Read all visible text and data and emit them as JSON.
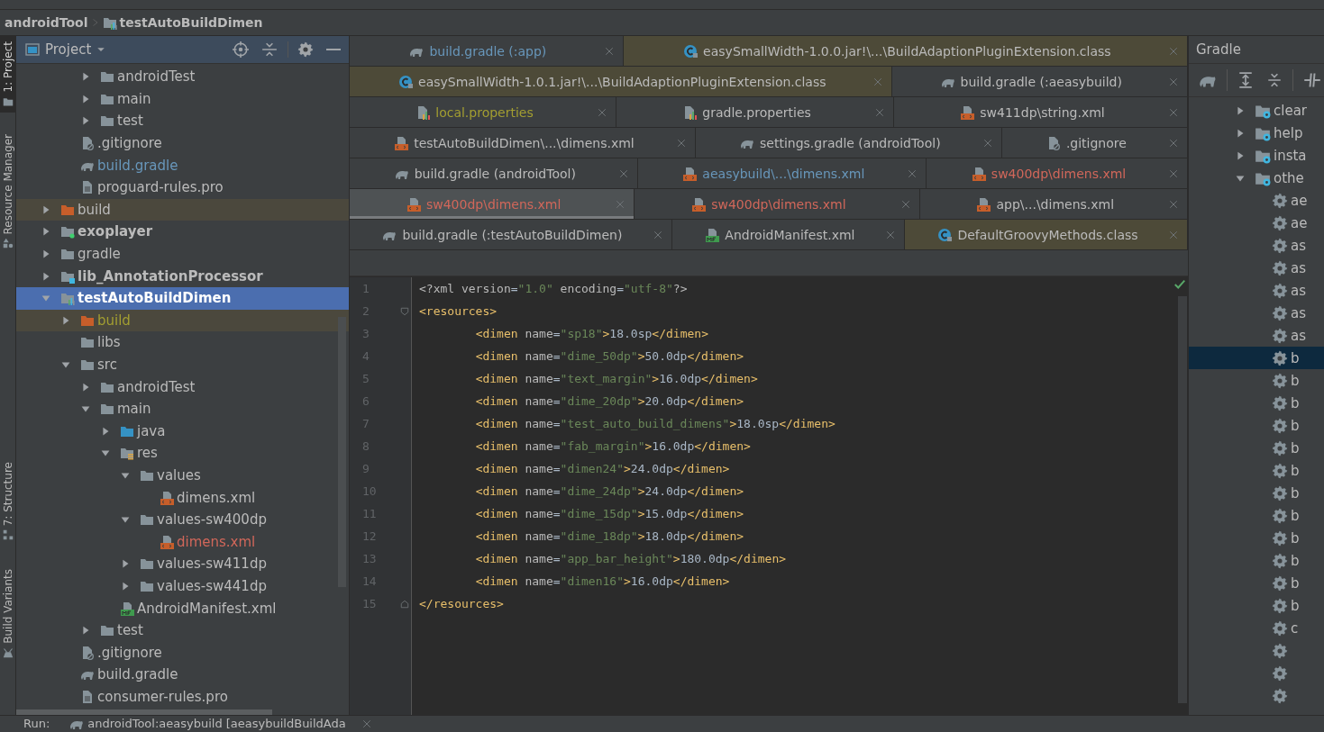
{
  "breadcrumb": [
    {
      "label": "androidTool",
      "kind": "plain"
    },
    {
      "label": "testAutoBuildDimen",
      "kind": "module"
    }
  ],
  "side_tools": [
    {
      "label": "1: Project",
      "selected": true,
      "kind": "folder"
    },
    {
      "label": "Resource Manager",
      "selected": false,
      "kind": "shapes"
    },
    {
      "label": "7: Structure",
      "selected": false,
      "kind": "structure"
    },
    {
      "label": "Build Variants",
      "selected": false,
      "kind": "variants"
    }
  ],
  "project_panel": {
    "title": "Project",
    "tree": [
      {
        "children": [
          {
            "children": [
              {
                "label": "androidTest",
                "kind": "folder",
                "expanded": false
              },
              {
                "label": "main",
                "kind": "folder",
                "expanded": false
              },
              {
                "label": "test",
                "kind": "folder",
                "expanded": false
              }
            ]
          },
          {
            "label": ".gitignore",
            "kind": "ignore"
          },
          {
            "label": "build.gradle",
            "kind": "gradle",
            "color": "#6897bb"
          },
          {
            "label": "proguard-rules.pro",
            "kind": "text"
          }
        ]
      },
      {
        "label": "build",
        "kind": "excluded",
        "expanded": false
      },
      {
        "label": "exoplayer",
        "kind": "module-green",
        "expanded": false
      },
      {
        "label": "gradle",
        "kind": "folder",
        "expanded": false
      },
      {
        "label": "lib_AnnotationProcessor",
        "kind": "module-blue",
        "expanded": false
      },
      {
        "label": "testAutoBuildDimen",
        "kind": "module",
        "expanded": true,
        "selected": true,
        "children": [
          {
            "label": "build",
            "kind": "excluded",
            "expanded": false,
            "color": "#a39e31"
          },
          {
            "label": "libs",
            "kind": "folder"
          },
          {
            "label": "src",
            "kind": "folder",
            "expanded": true,
            "children": [
              {
                "label": "androidTest",
                "kind": "folder",
                "expanded": false
              },
              {
                "label": "main",
                "kind": "folder",
                "expanded": true,
                "children": [
                  {
                    "label": "java",
                    "kind": "source",
                    "expanded": false
                  },
                  {
                    "label": "res",
                    "kind": "resources",
                    "expanded": true,
                    "children": [
                      {
                        "label": "values",
                        "kind": "folder",
                        "expanded": true,
                        "children": [
                          {
                            "label": "dimens.xml",
                            "kind": "xml"
                          }
                        ]
                      },
                      {
                        "label": "values-sw400dp",
                        "kind": "folder",
                        "expanded": true,
                        "children": [
                          {
                            "label": "dimens.xml",
                            "kind": "xml",
                            "color": "#d1675a"
                          }
                        ]
                      },
                      {
                        "label": "values-sw411dp",
                        "kind": "folder",
                        "expanded": false
                      },
                      {
                        "label": "values-sw441dp",
                        "kind": "folder",
                        "expanded": false
                      }
                    ]
                  },
                  {
                    "label": "AndroidManifest.xml",
                    "kind": "manifest"
                  }
                ]
              },
              {
                "label": "test",
                "kind": "folder",
                "expanded": false
              }
            ]
          },
          {
            "label": ".gitignore",
            "kind": "ignore"
          },
          {
            "label": "build.gradle",
            "kind": "gradle"
          },
          {
            "label": "consumer-rules.pro",
            "kind": "text"
          }
        ]
      }
    ]
  },
  "editor_tabs": [
    [
      {
        "label": "build.gradle (:app)",
        "kind": "gradle",
        "color": "#6897bb",
        "selected": false,
        "external": false
      },
      {
        "label": "easySmallWidth-1.0.0.jar!\\...\\BuildAdaptionPluginExtension.class",
        "kind": "class",
        "selected": false,
        "external": true
      }
    ],
    [
      {
        "label": "easySmallWidth-1.0.1.jar!\\...\\BuildAdaptionPluginExtension.class",
        "kind": "class",
        "selected": false,
        "external": true
      },
      {
        "label": "build.gradle (:aeasybuild)",
        "kind": "gradle",
        "selected": false,
        "external": false
      }
    ],
    [
      {
        "label": "local.properties",
        "kind": "properties",
        "color": "#a39e31",
        "selected": false,
        "external": false
      },
      {
        "label": "gradle.properties",
        "kind": "properties",
        "selected": false,
        "external": false
      },
      {
        "label": "sw411dp\\string.xml",
        "kind": "xml",
        "selected": false,
        "external": false
      }
    ],
    [
      {
        "label": "testAutoBuildDimen\\...\\dimens.xml",
        "kind": "xml",
        "selected": false,
        "external": false
      },
      {
        "label": "settings.gradle (androidTool)",
        "kind": "gradle",
        "selected": false,
        "external": false
      },
      {
        "label": ".gitignore",
        "kind": "ignore",
        "selected": false,
        "external": false
      }
    ],
    [
      {
        "label": "build.gradle (androidTool)",
        "kind": "gradle",
        "selected": false,
        "external": false
      },
      {
        "label": "aeasybuild\\...\\dimens.xml",
        "kind": "xml",
        "color": "#6897bb",
        "selected": false,
        "external": false
      },
      {
        "label": "sw400dp\\dimens.xml",
        "kind": "xml",
        "color": "#d1675a",
        "selected": false,
        "external": false
      }
    ],
    [
      {
        "label": "sw400dp\\dimens.xml",
        "kind": "xml",
        "color": "#d1675a",
        "selected": true,
        "external": false
      },
      {
        "label": "sw400dp\\dimens.xml",
        "kind": "xml",
        "color": "#d1675a",
        "selected": false,
        "external": false
      },
      {
        "label": "app\\...\\dimens.xml",
        "kind": "xml",
        "selected": false,
        "external": false
      }
    ],
    [
      {
        "label": "build.gradle (:testAutoBuildDimen)",
        "kind": "gradle",
        "selected": false,
        "external": false
      },
      {
        "label": "AndroidManifest.xml",
        "kind": "manifest",
        "selected": false,
        "external": false
      },
      {
        "label": "DefaultGroovyMethods.class",
        "kind": "class",
        "selected": false,
        "external": true
      }
    ]
  ],
  "code": [
    {
      "number": "1",
      "text": "<?xml version=\"1.0\" encoding=\"utf-8\"?>",
      "kind": "plain"
    },
    {
      "number": "2",
      "text": "<resources>",
      "kind": "fold-start"
    },
    {
      "number": "3",
      "text": "        <dimen name=\"sp18\">18.0sp</dimen>",
      "kind": "plain"
    },
    {
      "number": "4",
      "text": "        <dimen name=\"dime_50dp\">50.0dp</dimen>",
      "kind": "plain"
    },
    {
      "number": "5",
      "text": "        <dimen name=\"text_margin\">16.0dp</dimen>",
      "kind": "plain"
    },
    {
      "number": "6",
      "text": "        <dimen name=\"dime_20dp\">20.0dp</dimen>",
      "kind": "plain"
    },
    {
      "number": "7",
      "text": "        <dimen name=\"test_auto_build_dimens\">18.0sp</dimen>",
      "kind": "plain"
    },
    {
      "number": "8",
      "text": "        <dimen name=\"fab_margin\">16.0dp</dimen>",
      "kind": "plain"
    },
    {
      "number": "9",
      "text": "        <dimen name=\"dimen24\">24.0dp</dimen>",
      "kind": "plain"
    },
    {
      "number": "10",
      "text": "        <dimen name=\"dime_24dp\">24.0dp</dimen>",
      "kind": "plain"
    },
    {
      "number": "11",
      "text": "        <dimen name=\"dime_15dp\">15.0dp</dimen>",
      "kind": "plain"
    },
    {
      "number": "12",
      "text": "        <dimen name=\"dime_18dp\">18.0dp</dimen>",
      "kind": "plain"
    },
    {
      "number": "13",
      "text": "        <dimen name=\"app_bar_height\">180.0dp</dimen>",
      "kind": "plain"
    },
    {
      "number": "14",
      "text": "        <dimen name=\"dimen16\">16.0dp</dimen>",
      "kind": "plain"
    },
    {
      "number": "15",
      "text": "</resources>",
      "kind": "fold-end"
    }
  ],
  "gradle_panel": {
    "title": "Gradle",
    "tasks": [
      {
        "label": "clear",
        "kind": "group",
        "expanded": false
      },
      {
        "label": "help",
        "kind": "group",
        "expanded": false
      },
      {
        "label": "insta",
        "kind": "group",
        "expanded": false
      },
      {
        "label": "othe",
        "kind": "group",
        "expanded": true,
        "children": [
          {
            "label": "ae",
            "kind": "task",
            "selected": false
          },
          {
            "label": "ae",
            "kind": "task",
            "selected": false
          },
          {
            "label": "as",
            "kind": "task",
            "selected": false
          },
          {
            "label": "as",
            "kind": "task",
            "selected": false
          },
          {
            "label": "as",
            "kind": "task",
            "selected": false
          },
          {
            "label": "as",
            "kind": "task",
            "selected": false
          },
          {
            "label": "as",
            "kind": "task",
            "selected": false
          },
          {
            "label": "b",
            "kind": "task",
            "selected": true
          },
          {
            "label": "b",
            "kind": "task",
            "selected": false
          },
          {
            "label": "b",
            "kind": "task",
            "selected": false
          },
          {
            "label": "b",
            "kind": "task",
            "selected": false
          },
          {
            "label": "b",
            "kind": "task",
            "selected": false
          },
          {
            "label": "b",
            "kind": "task",
            "selected": false
          },
          {
            "label": "b",
            "kind": "task",
            "selected": false
          },
          {
            "label": "b",
            "kind": "task",
            "selected": false
          },
          {
            "label": "b",
            "kind": "task",
            "selected": false
          },
          {
            "label": "b",
            "kind": "task",
            "selected": false
          },
          {
            "label": "b",
            "kind": "task",
            "selected": false
          },
          {
            "label": "b",
            "kind": "task",
            "selected": false
          },
          {
            "label": "c",
            "kind": "task",
            "selected": false
          },
          {
            "kind": "task",
            "selected": false
          },
          {
            "kind": "task",
            "selected": false
          },
          {
            "kind": "task",
            "selected": false
          }
        ]
      }
    ]
  },
  "bottom_bar": {
    "label": "Run:",
    "run_tab": "androidTool:aeasybuild [aeasybuildBuildAda"
  }
}
